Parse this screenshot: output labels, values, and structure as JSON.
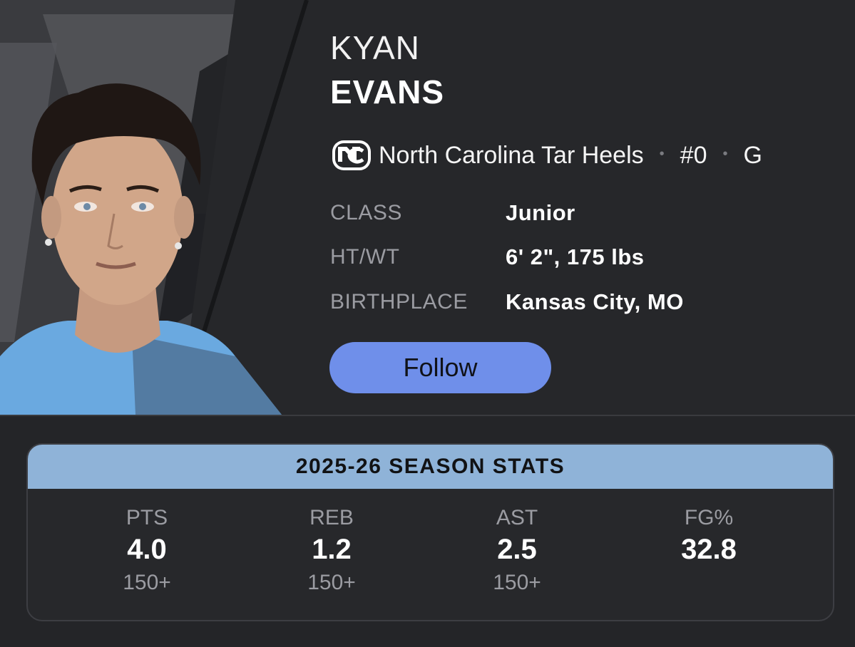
{
  "player": {
    "first_name": "KYAN",
    "last_name": "EVANS",
    "team": "North Carolina Tar Heels",
    "number": "#0",
    "position": "G",
    "separator": "•"
  },
  "details": [
    {
      "label": "CLASS",
      "value": "Junior"
    },
    {
      "label": "HT/WT",
      "value": "6' 2\", 175 lbs"
    },
    {
      "label": "BIRTHPLACE",
      "value": "Kansas City, MO"
    }
  ],
  "follow_label": "Follow",
  "stats": {
    "title": "2025-26 SEASON STATS",
    "columns": [
      {
        "label": "PTS",
        "value": "4.0",
        "rank": "150+"
      },
      {
        "label": "REB",
        "value": "1.2",
        "rank": "150+"
      },
      {
        "label": "AST",
        "value": "2.5",
        "rank": "150+"
      },
      {
        "label": "FG%",
        "value": "32.8",
        "rank": ""
      }
    ]
  },
  "colors": {
    "background": "#242528",
    "accent_button": "#6f8fea",
    "stats_header": "#8fb3d8",
    "carolina_blue": "#7bafd4"
  },
  "icons": {
    "team_logo": "unc-logo-icon"
  }
}
